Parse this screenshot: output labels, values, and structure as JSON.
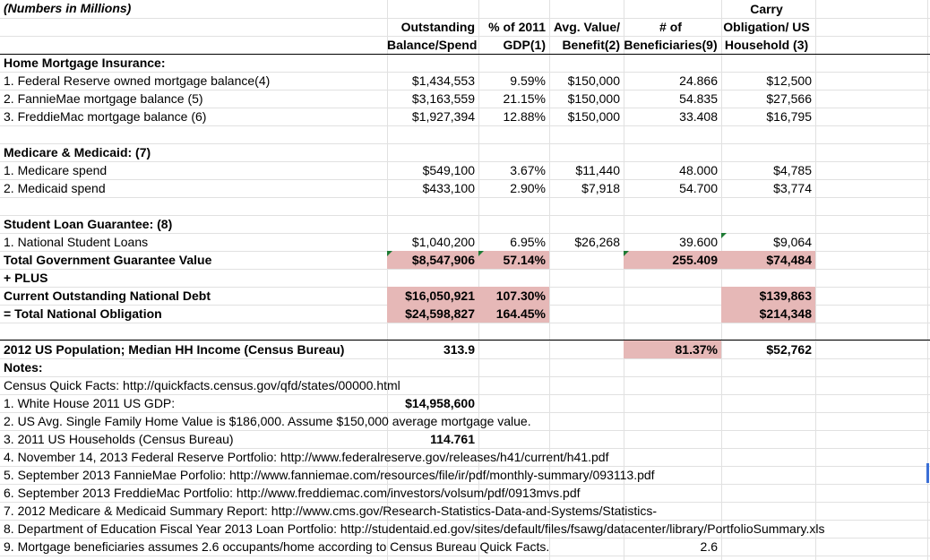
{
  "title_note": "(Numbers in Millions)",
  "headers": {
    "col_b": [
      "Outstanding",
      "Balance/Spend"
    ],
    "col_c": [
      "% of 2011",
      "GDP(1)"
    ],
    "col_d": [
      "Avg. Value/",
      "Benefit(2)"
    ],
    "col_e": [
      "# of",
      "Beneficiaries(9)"
    ],
    "col_f": [
      "Carry",
      "Obligation/ US",
      "Household (3)"
    ]
  },
  "rows": [
    {
      "label": "Home Mortgage Insurance:",
      "bold": true
    },
    {
      "label": "1.  Federal Reserve owned mortgage balance(4)",
      "b": "$1,434,553",
      "c": "9.59%",
      "d": "$150,000",
      "e": "24.866",
      "f": "$12,500"
    },
    {
      "label": "2. FannieMae mortgage balance (5)",
      "b": "$3,163,559",
      "c": "21.15%",
      "d": "$150,000",
      "e": "54.835",
      "f": "$27,566"
    },
    {
      "label": "3. FreddieMac mortgage balance (6)",
      "b": "$1,927,394",
      "c": "12.88%",
      "d": "$150,000",
      "e": "33.408",
      "f": "$16,795"
    },
    {
      "label": ""
    },
    {
      "label": "Medicare & Medicaid: (7)",
      "bold": true
    },
    {
      "label": "1. Medicare spend",
      "b": "$549,100",
      "c": "3.67%",
      "d": "$11,440",
      "e": "48.000",
      "f": "$4,785"
    },
    {
      "label": "2. Medicaid spend",
      "b": "$433,100",
      "c": "2.90%",
      "d": "$7,918",
      "e": "54.700",
      "f": "$3,774"
    },
    {
      "label": ""
    },
    {
      "label": "Student Loan Guarantee: (8)",
      "bold": true
    },
    {
      "label": "1. National Student Loans",
      "b": "$1,040,200",
      "c": "6.95%",
      "d": "$26,268",
      "e": "39.600",
      "f": "$9,064"
    },
    {
      "label": " Total Government Guarantee Value",
      "b": "$8,547,906",
      "c": "57.14%",
      "d": "",
      "e": "255.409",
      "f": "$74,484",
      "bold": true
    },
    {
      "label": "+ PLUS",
      "bold": true
    },
    {
      "label": "Current Outstanding National Debt",
      "b": "$16,050,921",
      "c": "107.30%",
      "d": "",
      "e": "",
      "f": "$139,863",
      "bold": true
    },
    {
      "label": "= Total National Obligation",
      "b": "$24,598,827",
      "c": "164.45%",
      "d": "",
      "e": "",
      "f": "$214,348",
      "bold": true
    },
    {
      "label": ""
    },
    {
      "label": "2012 US Population; Median HH Income (Census Bureau)",
      "b": "313.9",
      "e": "81.37%",
      "f": "$52,762",
      "bold": true
    }
  ],
  "notes": [
    {
      "text": "Notes:",
      "bold": true
    },
    {
      "text": "Census Quick Facts: http://quickfacts.census.gov/qfd/states/00000.html"
    },
    {
      "text": "1. White House 2011 US GDP:",
      "value": "$14,958,600"
    },
    {
      "text": "2. US Avg. Single Family Home Value is $186,000. Assume $150,000 average mortgage value."
    },
    {
      "text": "3. 2011 US Households (Census Bureau)",
      "value": "114.761"
    },
    {
      "text": "4. November 14, 2013 Federal Reserve Portfolio: http://www.federalreserve.gov/releases/h41/current/h41.pdf"
    },
    {
      "text": "5. September 2013 FannieMae Porfolio: http://www.fanniemae.com/resources/file/ir/pdf/monthly-summary/093113.pdf"
    },
    {
      "text": "6. September 2013 FreddieMac Portfolio: http://www.freddiemac.com/investors/volsum/pdf/0913mvs.pdf"
    },
    {
      "text": "7. 2012 Medicare & Medicaid Summary Report: http://www.cms.gov/Research-Statistics-Data-and-Systems/Statistics-"
    },
    {
      "text": "8. Department of Education Fiscal Year 2013 Loan Portfolio: http://studentaid.ed.gov/sites/default/files/fsawg/datacenter/library/PortfolioSummary.xls"
    },
    {
      "text": "9. Mortgage beneficiaries assumes 2.6 occupants/home according to Census Bureau Quick Facts.",
      "value_e": "2.6"
    }
  ],
  "colors": {
    "highlight": "#e6b8b7",
    "gridline": "#e1e1e1",
    "comment_marker": "#1e7b34"
  }
}
